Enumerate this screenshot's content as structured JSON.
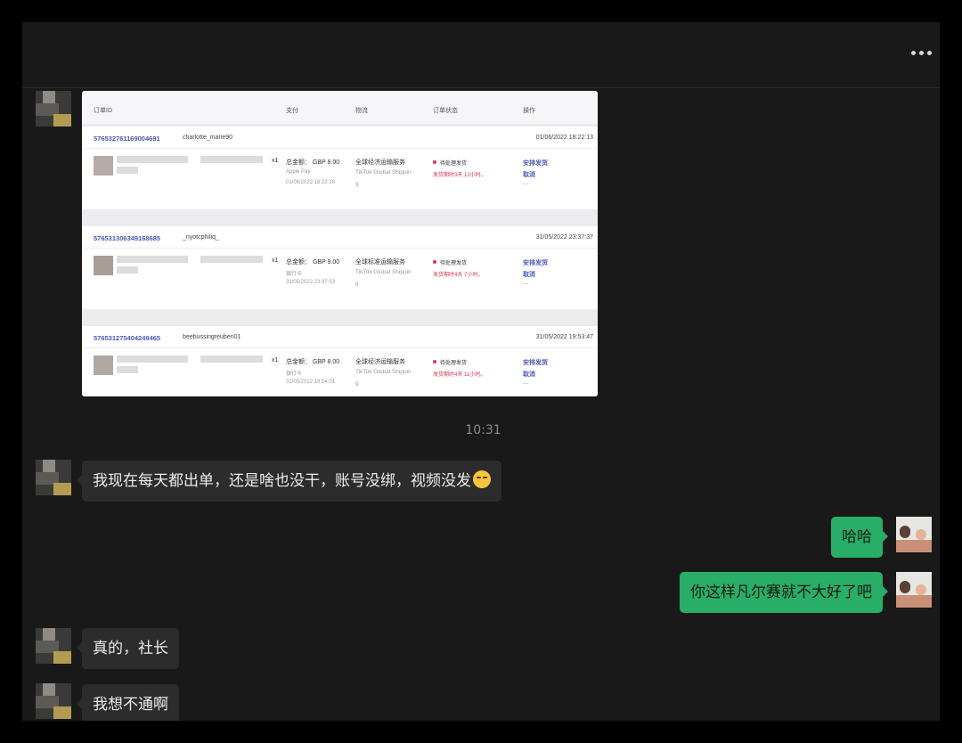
{
  "chat": {
    "time_separator": "10:31",
    "messages": [
      {
        "side": "left",
        "text": "我现在每天都出单，还是啥也没干，账号没绑，视频没发",
        "emoji": "face-with-tears-of-joy"
      },
      {
        "side": "right",
        "text": "哈哈"
      },
      {
        "side": "right",
        "text": "你这样凡尔赛就不大好了吧"
      },
      {
        "side": "left",
        "text": "真的，社长"
      },
      {
        "side": "left",
        "text": "我想不通啊"
      }
    ]
  },
  "screenshot": {
    "headers": {
      "order_id": "订单ID",
      "payment": "支付",
      "logistics": "物流",
      "status": "订单状态",
      "action": "操作"
    },
    "orders": [
      {
        "id": "576532761169004691",
        "user": "charlotte_marie90",
        "date": "01/06/2022 18:22:13",
        "qty": "x1",
        "total": "总金额： GBP 8.00",
        "pay_method": "Apple Pay",
        "pay_time": "01/06/2022 18:22:18",
        "logistics": "全球经济运输服务",
        "carrier": "TikTok Global Shippin",
        "carrier_tail": "g",
        "status": "待处理发货",
        "deadline": "发货期时3天 12小时。",
        "action1": "安排发货",
        "action2": "取消",
        "more": "..."
      },
      {
        "id": "576531306349168685",
        "user": "_nyotcphiliq_",
        "date": "31/05/2022 23:37:37",
        "qty": "x1",
        "total": "总金额： GBP 9.00",
        "pay_method": "银行卡",
        "pay_time": "31/05/2022 23:37:53",
        "logistics": "全球标准运输服务",
        "carrier": "TikTok Global Shippin",
        "carrier_tail": "g",
        "status": "待处理发货",
        "deadline": "发货期时4天 7小时。",
        "action1": "安排发货",
        "action2": "取消",
        "more": "..."
      },
      {
        "id": "576531275404249465",
        "user": "beebussingreuben01",
        "date": "31/05/2022 19:53:47",
        "qty": "x1",
        "total": "总金额： GBP 8.00",
        "pay_method": "银行卡",
        "pay_time": "31/05/2022 19:54:01",
        "logistics": "全球经济运输服务",
        "carrier": "TikTok Global Shippin",
        "carrier_tail": "g",
        "status": "待处理发货",
        "deadline": "发货期时4天 11小时。",
        "action1": "安排发货",
        "action2": "取消",
        "more": "..."
      }
    ]
  }
}
